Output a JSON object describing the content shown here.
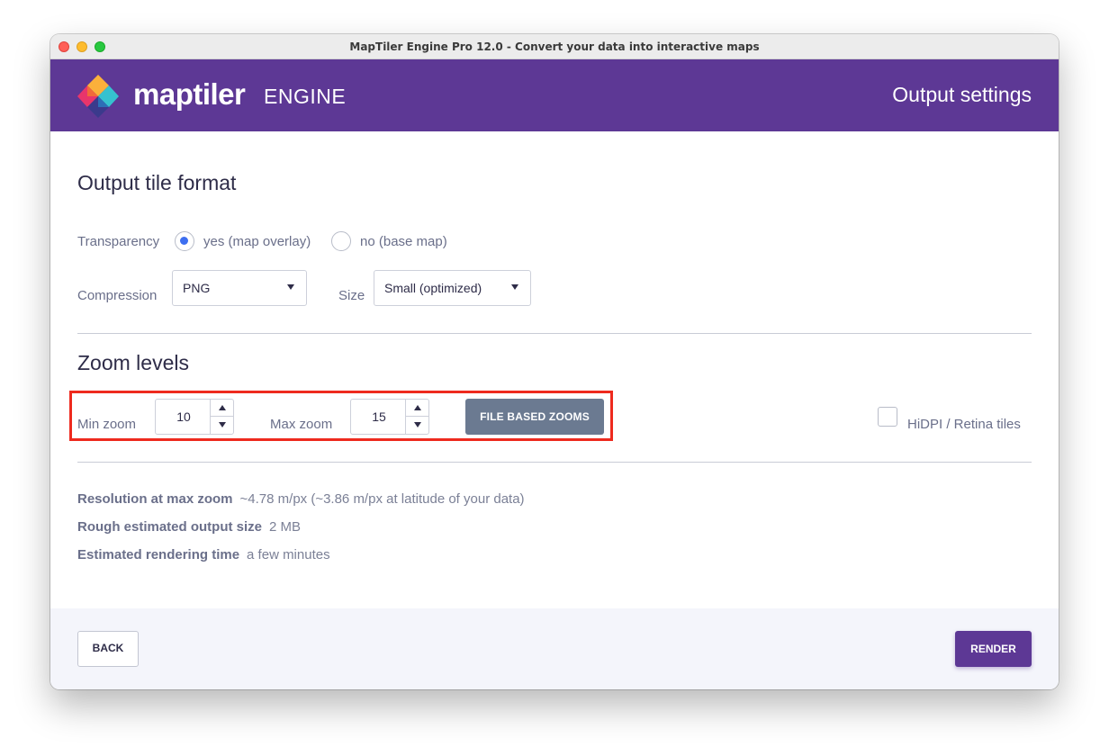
{
  "window": {
    "title": "MapTiler Engine Pro 12.0 - Convert your data into interactive maps"
  },
  "header": {
    "brand": "maptiler",
    "brand_suffix": "ENGINE",
    "page_title": "Output settings"
  },
  "output_tile_format": {
    "title": "Output tile format",
    "transparency": {
      "label": "Transparency",
      "options": [
        {
          "label": "yes (map overlay)",
          "selected": true
        },
        {
          "label": "no (base map)",
          "selected": false
        }
      ]
    },
    "compression": {
      "label": "Compression",
      "value": "PNG"
    },
    "size": {
      "label": "Size",
      "value": "Small (optimized)"
    }
  },
  "zoom_levels": {
    "title": "Zoom levels",
    "min_zoom": {
      "label": "Min zoom",
      "value": "10"
    },
    "max_zoom": {
      "label": "Max zoom",
      "value": "15"
    },
    "file_based_button": "FILE BASED ZOOMS",
    "hidpi": {
      "label": "HiDPI / Retina tiles",
      "checked": false
    }
  },
  "estimates": [
    {
      "key": "Resolution at max zoom",
      "value": "~4.78 m/px (~3.86 m/px at latitude of your data)"
    },
    {
      "key": "Rough estimated output size",
      "value": "2 MB"
    },
    {
      "key": "Estimated rendering time",
      "value": "a few minutes"
    }
  ],
  "footer": {
    "back_label": "BACK",
    "render_label": "RENDER"
  },
  "colors": {
    "brand_purple": "#5d3895",
    "highlight_red": "#ee2a1e",
    "radio_blue": "#3d6ef0",
    "secondary_button": "#6b7a91"
  }
}
